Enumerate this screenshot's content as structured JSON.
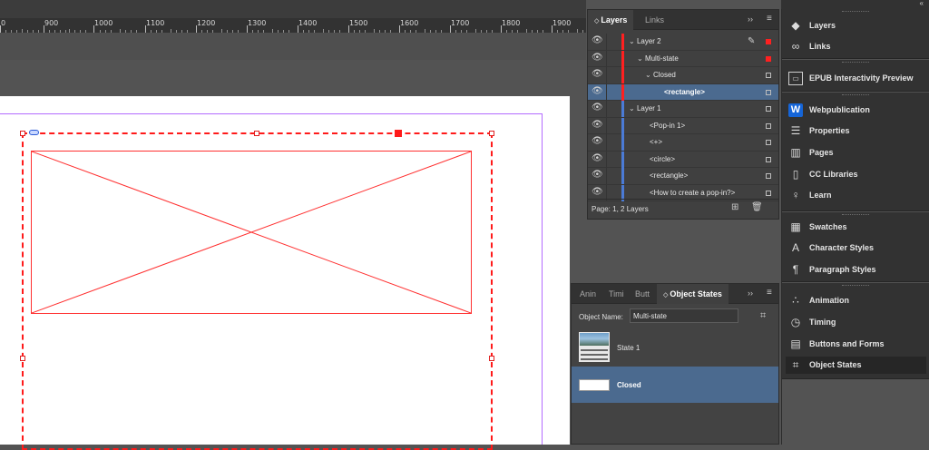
{
  "ruler": {
    "labels": [
      "0",
      "900",
      "1000",
      "1100",
      "1200",
      "1300",
      "1400",
      "1500",
      "1600",
      "1700",
      "1800",
      "1900"
    ]
  },
  "layers_panel": {
    "tabs": [
      {
        "label": "Layers"
      },
      {
        "label": "Links"
      }
    ],
    "rows": [
      {
        "label": "Layer 2",
        "chevron": "⌄",
        "color": "#ff2020",
        "square": "red"
      },
      {
        "label": "Multi-state",
        "chevron": "⌄",
        "color": "#ff2020",
        "square": "red"
      },
      {
        "label": "Closed",
        "chevron": "⌄",
        "color": "#ff2020",
        "square": "outline"
      },
      {
        "label": "<rectangle>",
        "chevron": "",
        "color": "#ff2020",
        "square": "outline"
      },
      {
        "label": "Layer 1",
        "chevron": "⌄",
        "color": "#4b7bd6",
        "square": "outline"
      },
      {
        "label": "<Pop-in 1>",
        "chevron": "",
        "color": "#4b7bd6",
        "square": "outline"
      },
      {
        "label": "<+>",
        "chevron": "",
        "color": "#4b7bd6",
        "square": "outline"
      },
      {
        "label": "<circle>",
        "chevron": "",
        "color": "#4b7bd6",
        "square": "outline"
      },
      {
        "label": "<rectangle>",
        "chevron": "",
        "color": "#4b7bd6",
        "square": "outline"
      },
      {
        "label": "<How to create a pop-in?>",
        "chevron": "",
        "color": "#4b7bd6",
        "square": "outline"
      }
    ],
    "footer_status": "Page: 1, 2 Layers"
  },
  "object_states_panel": {
    "tabs": [
      {
        "label": "Anin"
      },
      {
        "label": "Timi"
      },
      {
        "label": "Butt"
      },
      {
        "label": "Object States"
      }
    ],
    "object_name_label": "Object Name:",
    "object_name_value": "Multi-state",
    "states": [
      {
        "label": "State 1"
      },
      {
        "label": "Closed"
      }
    ]
  },
  "dock": {
    "groups": [
      [
        {
          "label": "Layers",
          "icon": "layers-icon"
        },
        {
          "label": "Links",
          "icon": "links-icon"
        }
      ],
      [
        {
          "label": "EPUB Interactivity Preview",
          "icon": "epub-preview-icon"
        }
      ],
      [
        {
          "label": "Webpublication",
          "icon": "webpublication-icon"
        },
        {
          "label": "Properties",
          "icon": "properties-icon"
        },
        {
          "label": "Pages",
          "icon": "pages-icon"
        },
        {
          "label": "CC Libraries",
          "icon": "cc-libraries-icon"
        },
        {
          "label": "Learn",
          "icon": "learn-icon"
        }
      ],
      [
        {
          "label": "Swatches",
          "icon": "swatches-icon"
        },
        {
          "label": "Character Styles",
          "icon": "character-styles-icon"
        },
        {
          "label": "Paragraph Styles",
          "icon": "paragraph-styles-icon"
        }
      ],
      [
        {
          "label": "Animation",
          "icon": "animation-icon"
        },
        {
          "label": "Timing",
          "icon": "timing-icon"
        },
        {
          "label": "Buttons and Forms",
          "icon": "buttons-forms-icon"
        },
        {
          "label": "Object States",
          "icon": "object-states-icon"
        }
      ]
    ]
  },
  "colors": {
    "selection": "#4b6a8f",
    "frame_red": "#ff1a1a",
    "margin_purple": "#b36bff",
    "layer2": "#ff2020",
    "layer1": "#4b7bd6"
  }
}
